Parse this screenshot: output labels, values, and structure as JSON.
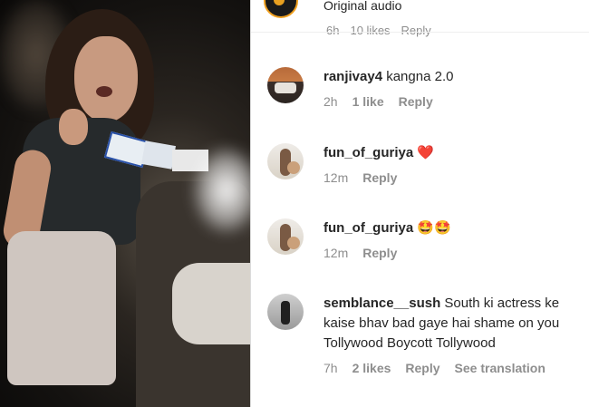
{
  "header": {
    "audio_label": "Original audio"
  },
  "previous_comment": {
    "time": "6h",
    "likes": "10 likes",
    "reply": "Reply"
  },
  "comments": [
    {
      "username": "ranjivay4",
      "text": "kangna 2.0",
      "time": "2h",
      "likes": "1 like",
      "reply": "Reply",
      "avatar_icon": "car-avatar"
    },
    {
      "username": "fun_of_guriya",
      "text": "",
      "emoji": "❤️",
      "time": "12m",
      "reply": "Reply",
      "avatar_icon": "girl-avatar"
    },
    {
      "username": "fun_of_guriya",
      "text": "",
      "emoji": "🤩🤩",
      "time": "12m",
      "reply": "Reply",
      "avatar_icon": "girl-avatar"
    },
    {
      "username": "semblance__sush",
      "text": "South ki actress ke kaise bhav bad gaye hai shame on you Tollywood Boycott Tollywood",
      "time": "7h",
      "likes": "2 likes",
      "reply": "Reply",
      "see_translation": "See translation",
      "avatar_icon": "man-avatar"
    }
  ],
  "colors": {
    "text": "#262626",
    "meta": "#8e8e8e",
    "heart": "#ed4956"
  }
}
